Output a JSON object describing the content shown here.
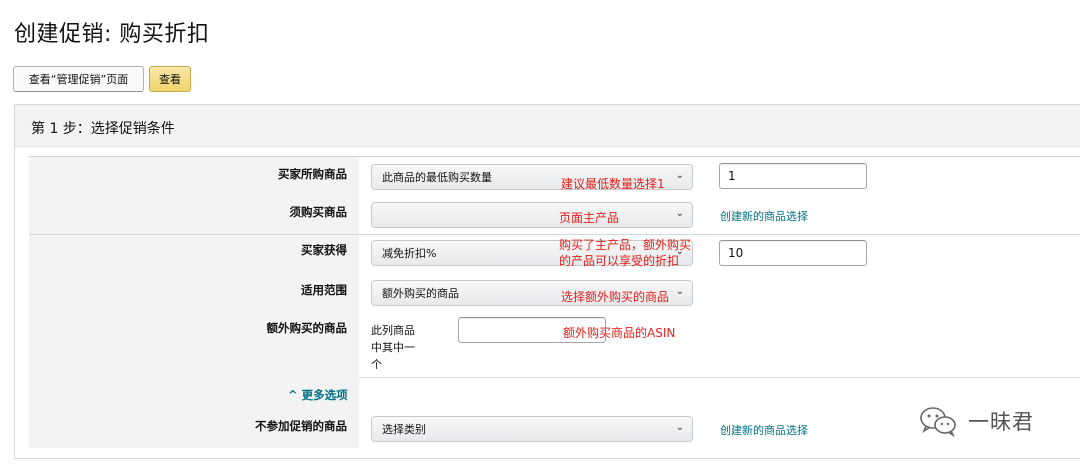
{
  "page": {
    "title": "创建促销: 购买折扣"
  },
  "toolbar": {
    "view_manage_label": "查看“管理促销”页面",
    "view_label": "查看"
  },
  "step": {
    "title": "第 1 步：选择促销条件"
  },
  "form": {
    "buyer_buys": {
      "label": "买家所购商品",
      "select_value": "此商品的最低购买数量",
      "input_value": "1",
      "annotation": "建议最低数量选择1"
    },
    "must_buy": {
      "label": "须购买商品",
      "select_value": "",
      "annotation": "页面主产品",
      "link": "创建新的商品选择"
    },
    "buyer_gets": {
      "label": "买家获得",
      "select_value": "减免折扣%",
      "input_value": "10",
      "annotation_line1": "购买了主产品，额外购买",
      "annotation_line2": "的产品可以享受的折扣"
    },
    "applies_to": {
      "label": "适用范围",
      "select_value": "额外购买的商品",
      "annotation": "选择额外购买的商品"
    },
    "extra_items": {
      "label": "额外购买的商品",
      "text_line1": "此列商品",
      "text_line2": "中其中一",
      "text_line3": "个",
      "input_value": "",
      "annotation": "额外购买商品的ASIN"
    },
    "more_options": "^ 更多选项",
    "excluded": {
      "label": "不参加促销的商品",
      "select_value": "选择类别",
      "link": "创建新的商品选择"
    }
  },
  "watermark": {
    "text": "一昧君",
    "icon": "wechat-icon"
  },
  "colors": {
    "annotation": "#e0201b",
    "link": "#007185",
    "primary_button": "#f0d46c"
  }
}
